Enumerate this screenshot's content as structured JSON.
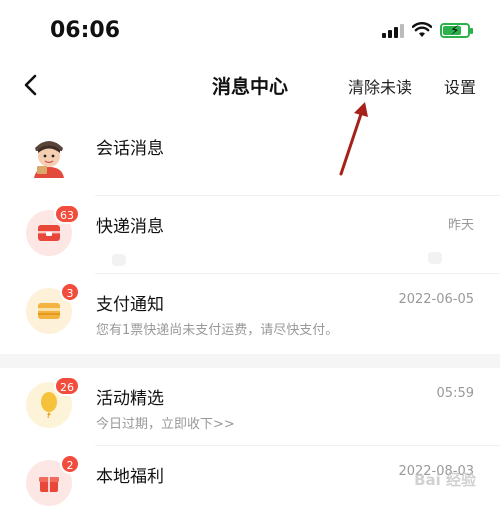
{
  "status_bar": {
    "time": "06:06",
    "signal_icon": "cellular-signal-icon",
    "wifi_icon": "wifi-icon",
    "battery_icon": "battery-charging-icon"
  },
  "nav": {
    "back_icon": "chevron-left-icon",
    "title": "消息中心",
    "clear_unread_label": "清除未读",
    "settings_label": "设置"
  },
  "annotation": {
    "arrow_color": "#a8201a",
    "arrow_points_to": "clear-unread-button"
  },
  "messages": [
    {
      "title": "会话消息",
      "time": "",
      "preview": "",
      "badge": "",
      "icon": "courier-avatar-icon",
      "icon_bg": "#ffffff"
    },
    {
      "title": "快递消息",
      "time": "昨天",
      "preview": "",
      "badge": "63",
      "icon": "package-icon",
      "icon_bg": "#fde7e5"
    },
    {
      "title": "支付通知",
      "time": "2022-06-05",
      "preview": "您有1票快递尚未支付运费，请尽快支付。",
      "badge": "3",
      "icon": "wallet-icon",
      "icon_bg": "#fdf1d9"
    },
    {
      "title": "活动精选",
      "time": "05:59",
      "preview": "今日过期，立即收下>>",
      "badge": "26",
      "icon": "balloon-icon",
      "icon_bg": "#fdf3d8"
    },
    {
      "title": "本地福利",
      "time": "2022-08-03",
      "preview": "",
      "badge": "2",
      "icon": "gift-icon",
      "icon_bg": "#fde7e5"
    }
  ],
  "watermark": "Bai 经验",
  "colors": {
    "badge": "#f24c3d",
    "accent_red": "#e8473a",
    "battery_green": "#2bb24c"
  }
}
